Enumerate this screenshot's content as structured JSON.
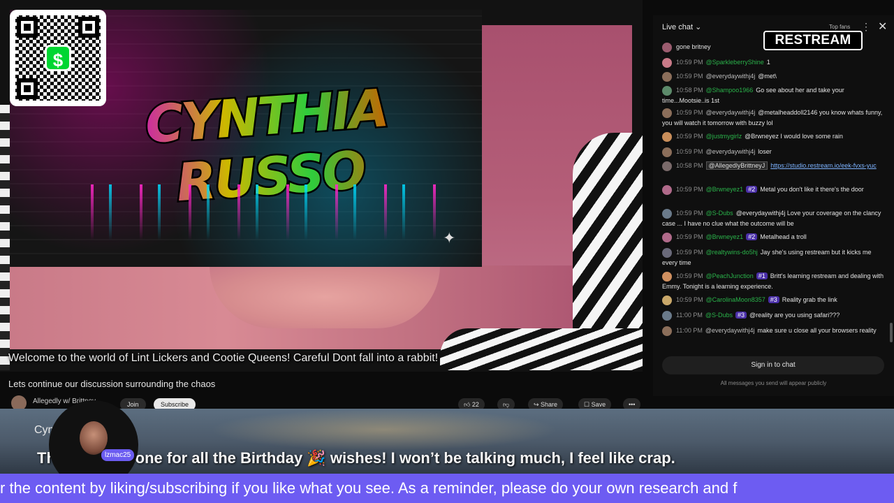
{
  "video": {
    "banner_title": "CYNTHIA RUSSO",
    "overlay_message": "Welcome to the world of Lint Lickers and Cootie Queens!  Careful Dont fall into a rabbit!",
    "qr_symbol": "$",
    "title": "Lets continue our discussion surrounding the chaos",
    "channel_name": "Allegedly w/ Brittney",
    "join_label": "Join",
    "subscribe_label": "Subscribe",
    "like_count": "22",
    "share_label": "Share",
    "save_label": "Save"
  },
  "chat": {
    "header": "Live chat",
    "top_fans": "Top fans",
    "restream_logo": "RESTREAM",
    "messages": [
      {
        "time": "",
        "user": "",
        "text": "gone britney",
        "color": "#9b5c6f"
      },
      {
        "time": "10:59 PM",
        "user": "@SparkleberryShine",
        "text": "1",
        "color": "#c97a88"
      },
      {
        "time": "10:59 PM",
        "user": "@everydaywithj4j",
        "text": "@met\\",
        "color": "#8b6e5a"
      },
      {
        "time": "10:58 PM",
        "user": "@Shampoo1966",
        "text": "Go see about her and take your time...Mootsie..is 1st",
        "color": "#5c8a6a"
      },
      {
        "time": "10:59 PM",
        "user": "@everydaywithj4j",
        "text": "@metalheaddoll2146 you know whats funny, you will watch it tomorrow with buzzy lol",
        "color": "#8b6e5a"
      },
      {
        "time": "10:59 PM",
        "user": "@justmygirlz",
        "text": "@Brwneyez I would love some rain",
        "color": "#c98e5a"
      },
      {
        "time": "10:59 PM",
        "user": "@everydaywithj4j",
        "text": "loser",
        "color": "#8b6e5a"
      },
      {
        "time": "10:58 PM",
        "user": "@AllegedlyBrittneyJ",
        "text": "https://studio.restream.io/eek-fvxs-yuc",
        "color": "#7a6a6a"
      },
      {
        "time": "10:59 PM",
        "user": "@Brwneyez1",
        "badge": "#2",
        "text": "Metal you don't like it there's the door",
        "color": "#b06a8a"
      },
      {
        "time": "10:59 PM",
        "user": "@S-Dubs",
        "text": "@everydaywithj4j Love your coverage on the clancy case ... I have no clue what the outcome will be",
        "color": "#6a7a8a"
      },
      {
        "time": "10:59 PM",
        "user": "@Brwneyez1",
        "badge": "#2",
        "text": "Metalhead a troll",
        "color": "#b06a8a"
      },
      {
        "time": "10:59 PM",
        "user": "@realtywins-do5hj",
        "text": "Jay she's using restream but it kicks me every time",
        "color": "#6a6a7a"
      },
      {
        "time": "10:59 PM",
        "user": "@PeachJunction",
        "badge": "#1",
        "text": "Britt's learning restream and dealing with Emmy. Tonight is a learning experience.",
        "color": "#d09060"
      },
      {
        "time": "10:59 PM",
        "user": "@CarolinaMoon8357",
        "badge": "#3",
        "text": "Reality grab the link",
        "color": "#c9a86a"
      },
      {
        "time": "11:00 PM",
        "user": "@S-Dubs",
        "badge": "#3",
        "text": "@reality are you using safari???",
        "color": "#6a7a8a"
      },
      {
        "time": "11:00 PM",
        "user": "@everydaywithj4j",
        "text": "make sure u close all your browsers reality",
        "color": "#8b6e5a"
      }
    ],
    "signin_label": "Sign in to chat",
    "public_note": "All messages you send will appear publicly"
  },
  "lower_third": {
    "name": "Cynthia Russo",
    "message": "Thanks everyone for all the Birthday 🎉 wishes! I won’t be talking much, I feel like crap.",
    "avatar_tag": "lzmac25"
  },
  "ticker": {
    "text": "r the content by liking/subscribing if you like what you see. As a reminder, please do your own research and f"
  },
  "colors": {
    "ticker_bg": "#6d5cf2",
    "chat_bg": "#0f0f0f",
    "username_green": "#2ab24a"
  }
}
